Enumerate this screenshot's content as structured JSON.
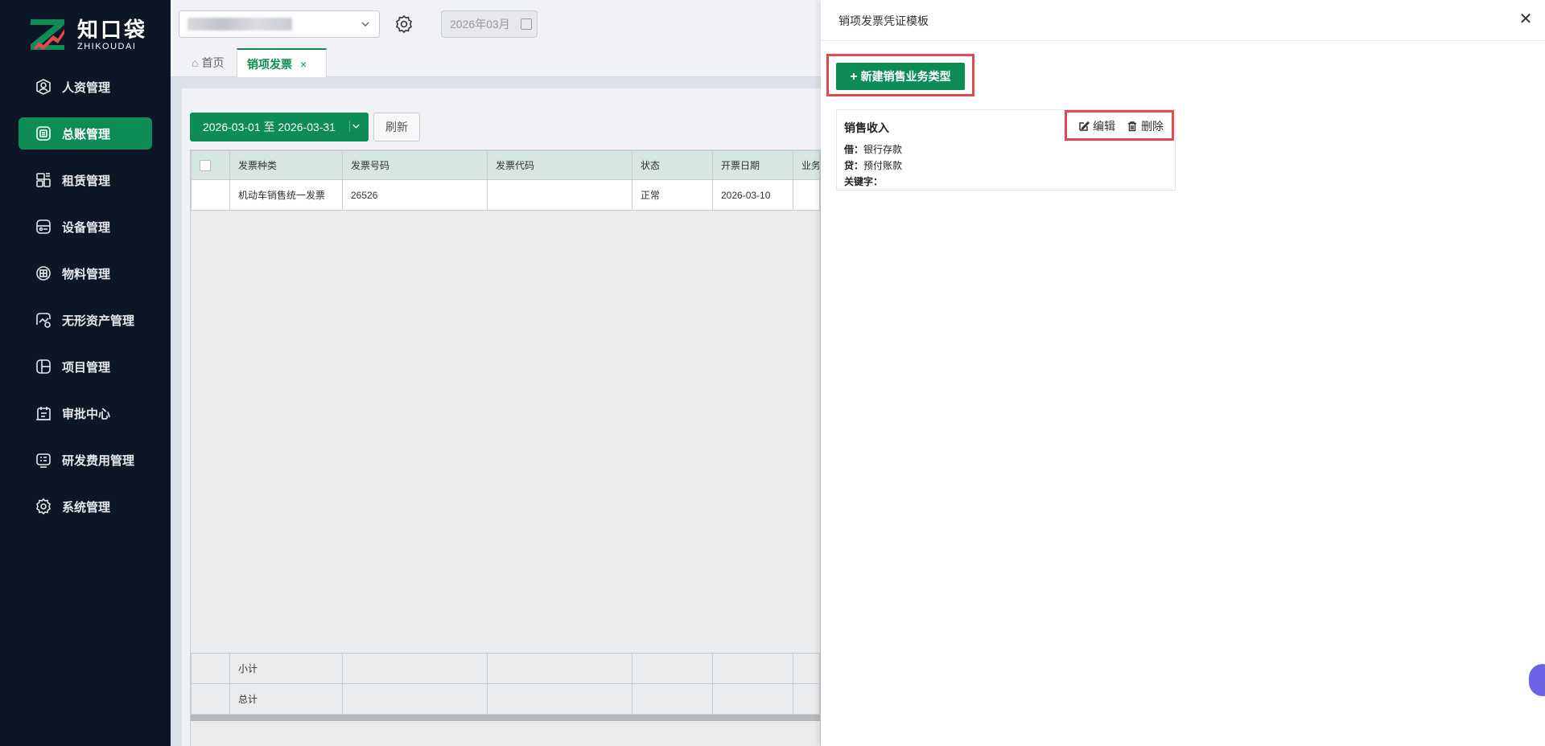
{
  "brand": {
    "name_cn": "知口袋",
    "name_en": "ZHIKOUDAI",
    "colors": {
      "primary": "#0e8c56",
      "sidebar": "#0d1626",
      "highlight": "#e5484d"
    }
  },
  "sidebar": {
    "items": [
      {
        "label": "人资管理",
        "icon": "user-circle-icon",
        "active": false
      },
      {
        "label": "总账管理",
        "icon": "ledger-icon",
        "active": true
      },
      {
        "label": "租赁管理",
        "icon": "lease-icon",
        "active": false
      },
      {
        "label": "设备管理",
        "icon": "device-icon",
        "active": false
      },
      {
        "label": "物料管理",
        "icon": "box-icon",
        "active": false
      },
      {
        "label": "无形资产管理",
        "icon": "asset-chart-icon",
        "active": false
      },
      {
        "label": "项目管理",
        "icon": "project-icon",
        "active": false
      },
      {
        "label": "审批中心",
        "icon": "approval-icon",
        "active": false
      },
      {
        "label": "研发费用管理",
        "icon": "rd-icon",
        "active": false
      },
      {
        "label": "系统管理",
        "icon": "gear-icon",
        "active": false
      }
    ]
  },
  "topbar": {
    "month": "2026年03月"
  },
  "tabs": {
    "home": "首页",
    "active": "销项发票",
    "close": "×"
  },
  "toolbar": {
    "date_range": "2026-03-01 至 2026-03-31",
    "refresh": "刷新"
  },
  "table": {
    "columns": [
      "发票种类",
      "发票号码",
      "发票代码",
      "状态",
      "开票日期",
      "业务"
    ],
    "rows": [
      [
        "机动车销售统一发票",
        "26526",
        "",
        "正常",
        "2026-03-10",
        ""
      ]
    ],
    "subtotal": "小计",
    "total": "总计"
  },
  "drawer": {
    "title": "销项发票凭证模板",
    "new_button": "新建销售业务类型",
    "card": {
      "title": "销售收入",
      "debit_label": "借：",
      "debit_value": "银行存款",
      "credit_label": "贷：",
      "credit_value": "预付账款",
      "keyword_label": "关键字：",
      "edit": "编辑",
      "delete": "删除"
    }
  }
}
